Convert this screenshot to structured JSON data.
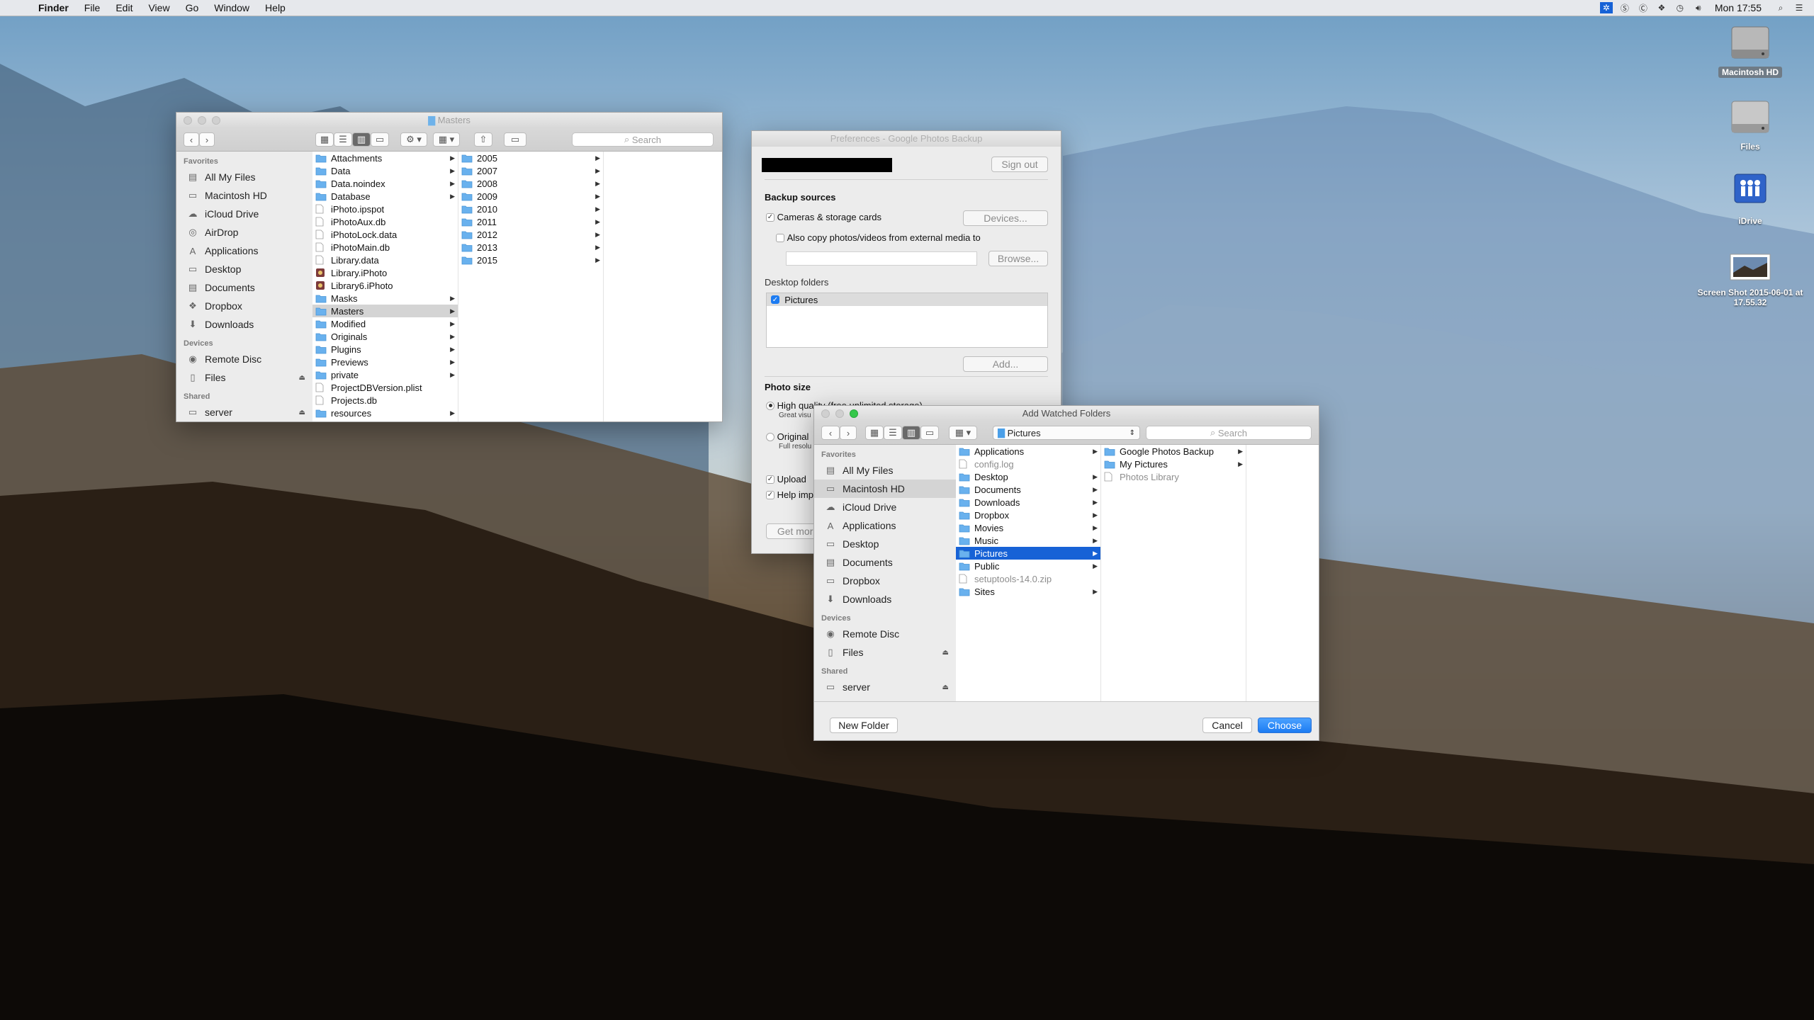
{
  "menubar": {
    "apple": "",
    "items": [
      "Finder",
      "File",
      "Edit",
      "View",
      "Go",
      "Window",
      "Help"
    ],
    "clock": "Mon 17:55"
  },
  "desktop_icons": [
    {
      "label": "Macintosh HD"
    },
    {
      "label": "Files"
    },
    {
      "label": "iDrive"
    },
    {
      "label": "Screen Shot 2015-06-01 at 17.55.32"
    }
  ],
  "finder": {
    "title": "Masters",
    "search_placeholder": "Search",
    "sidebar": {
      "favorites_header": "Favorites",
      "favorites": [
        "All My Files",
        "Macintosh HD",
        "iCloud Drive",
        "AirDrop",
        "Applications",
        "Desktop",
        "Documents",
        "Dropbox",
        "Downloads"
      ],
      "devices_header": "Devices",
      "devices": [
        "Remote Disc",
        "Files"
      ],
      "shared_header": "Shared",
      "shared": [
        "server"
      ]
    },
    "col1": [
      {
        "name": "Attachments",
        "kind": "folder",
        "arrow": true
      },
      {
        "name": "Data",
        "kind": "folder",
        "arrow": true
      },
      {
        "name": "Data.noindex",
        "kind": "folder",
        "arrow": true
      },
      {
        "name": "Database",
        "kind": "folder",
        "arrow": true
      },
      {
        "name": "iPhoto.ipspot",
        "kind": "file"
      },
      {
        "name": "iPhotoAux.db",
        "kind": "file"
      },
      {
        "name": "iPhotoLock.data",
        "kind": "file"
      },
      {
        "name": "iPhotoMain.db",
        "kind": "file"
      },
      {
        "name": "Library.data",
        "kind": "file"
      },
      {
        "name": "Library.iPhoto",
        "kind": "app"
      },
      {
        "name": "Library6.iPhoto",
        "kind": "app"
      },
      {
        "name": "Masks",
        "kind": "folder",
        "arrow": true
      },
      {
        "name": "Masters",
        "kind": "folder",
        "arrow": true,
        "selected": true
      },
      {
        "name": "Modified",
        "kind": "folder",
        "arrow": true
      },
      {
        "name": "Originals",
        "kind": "folder",
        "arrow": true
      },
      {
        "name": "Plugins",
        "kind": "folder",
        "arrow": true
      },
      {
        "name": "Previews",
        "kind": "folder",
        "arrow": true
      },
      {
        "name": "private",
        "kind": "folder",
        "arrow": true
      },
      {
        "name": "ProjectDBVersion.plist",
        "kind": "file"
      },
      {
        "name": "Projects.db",
        "kind": "file"
      },
      {
        "name": "resources",
        "kind": "folder",
        "arrow": true
      }
    ],
    "col2": [
      "2005",
      "2007",
      "2008",
      "2009",
      "2010",
      "2011",
      "2012",
      "2013",
      "2015"
    ]
  },
  "prefs": {
    "title": "Preferences - Google Photos Backup",
    "sign_out": "Sign out",
    "backup_sources_header": "Backup sources",
    "cameras_label": "Cameras & storage cards",
    "devices_button": "Devices...",
    "external_label": "Also copy photos/videos from external media to",
    "browse_button": "Browse...",
    "desktop_folders_header": "Desktop folders",
    "desktop_folders": [
      "Pictures"
    ],
    "add_button": "Add...",
    "photo_size_header": "Photo size",
    "high_quality_label": "High quality (free unlimited storage)",
    "high_quality_sub": "Great visu",
    "original_label": "Original",
    "original_sub": "Full resolu",
    "upload_label": "Upload",
    "help_label": "Help imp",
    "get_more": "Get more"
  },
  "dialog": {
    "title": "Add Watched Folders",
    "location": "Pictures",
    "search_placeholder": "Search",
    "sidebar": {
      "favorites_header": "Favorites",
      "favorites": [
        "All My Files",
        "Macintosh HD",
        "iCloud Drive",
        "Applications",
        "Desktop",
        "Documents",
        "Dropbox",
        "Downloads"
      ],
      "devices_header": "Devices",
      "devices": [
        "Remote Disc",
        "Files"
      ],
      "shared_header": "Shared",
      "shared": [
        "server"
      ]
    },
    "col1": [
      {
        "name": "Applications",
        "kind": "folder",
        "arrow": true
      },
      {
        "name": "config.log",
        "kind": "file",
        "dim": true
      },
      {
        "name": "Desktop",
        "kind": "folder",
        "arrow": true
      },
      {
        "name": "Documents",
        "kind": "folder",
        "arrow": true
      },
      {
        "name": "Downloads",
        "kind": "folder",
        "arrow": true
      },
      {
        "name": "Dropbox",
        "kind": "folder",
        "arrow": true
      },
      {
        "name": "Movies",
        "kind": "folder",
        "arrow": true
      },
      {
        "name": "Music",
        "kind": "folder",
        "arrow": true
      },
      {
        "name": "Pictures",
        "kind": "folder",
        "arrow": true,
        "selected": true
      },
      {
        "name": "Public",
        "kind": "folder",
        "arrow": true
      },
      {
        "name": "setuptools-14.0.zip",
        "kind": "file",
        "dim": true
      },
      {
        "name": "Sites",
        "kind": "folder",
        "arrow": true
      }
    ],
    "col2": [
      {
        "name": "Google Photos Backup",
        "kind": "folder",
        "arrow": true
      },
      {
        "name": "My Pictures",
        "kind": "folder",
        "arrow": true
      },
      {
        "name": "Photos Library",
        "kind": "file",
        "dim": true
      }
    ],
    "new_folder_button": "New Folder",
    "cancel_button": "Cancel",
    "choose_button": "Choose"
  }
}
